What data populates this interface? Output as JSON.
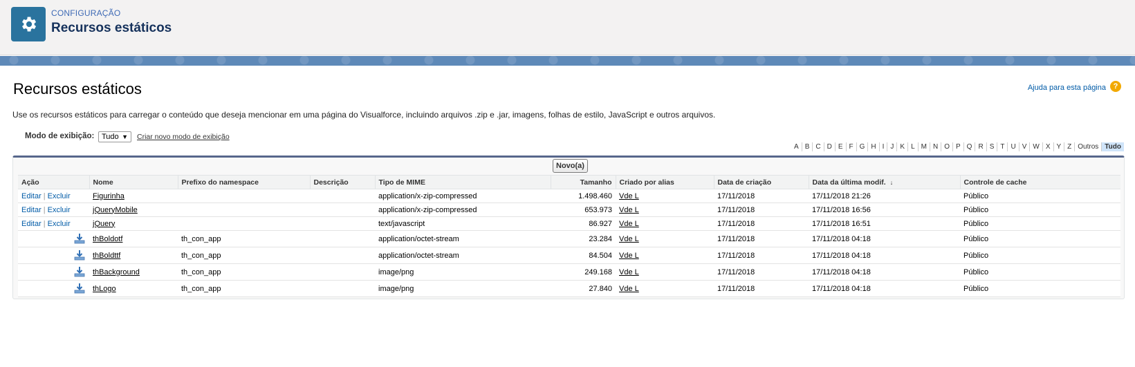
{
  "header": {
    "kicker": "CONFIGURAÇÃO",
    "title": "Recursos estáticos",
    "icon": "gear-icon"
  },
  "page": {
    "title": "Recursos estáticos",
    "help_link": "Ajuda para esta página",
    "help_icon": "?",
    "description": "Use os recursos estáticos para carregar o conteúdo que deseja mencionar em uma página do Visualforce, incluindo arquivos .zip e .jar, imagens, folhas de estilo, JavaScript e outros arquivos."
  },
  "view": {
    "label": "Modo de exibição:",
    "selected": "Tudo",
    "arrow": "▼",
    "create_link": "Criar novo modo de exibição"
  },
  "alphabet": [
    "A",
    "B",
    "C",
    "D",
    "E",
    "F",
    "G",
    "H",
    "I",
    "J",
    "K",
    "L",
    "M",
    "N",
    "O",
    "P",
    "Q",
    "R",
    "S",
    "T",
    "U",
    "V",
    "W",
    "X",
    "Y",
    "Z",
    "Outros",
    "Tudo"
  ],
  "alphabet_active": "Tudo",
  "list": {
    "new_button": "Novo(a)",
    "columns": {
      "action": "Ação",
      "name": "Nome",
      "namespace": "Prefixo do namespace",
      "description": "Descrição",
      "mime": "Tipo de MIME",
      "size": "Tamanho",
      "created_by": "Criado por alias",
      "created_date": "Data de criação",
      "modified_date": "Data da última modif.",
      "cache": "Controle de cache"
    },
    "sort_indicator": "↓",
    "edit_label": "Editar",
    "delete_label": "Excluir",
    "action_separator": "|",
    "rows": [
      {
        "name": "Figurinha",
        "namespace": "",
        "description": "",
        "mime": "application/x-zip-compressed",
        "size": "1.498.460",
        "created_by": "Vde L",
        "created_date": "17/11/2018",
        "modified_date": "17/11/2018 21:26",
        "cache": "Público",
        "editable": true
      },
      {
        "name": "jQueryMobile",
        "namespace": "",
        "description": "",
        "mime": "application/x-zip-compressed",
        "size": "653.973",
        "created_by": "Vde L",
        "created_date": "17/11/2018",
        "modified_date": "17/11/2018 16:56",
        "cache": "Público",
        "editable": true
      },
      {
        "name": "jQuery",
        "namespace": "",
        "description": "",
        "mime": "text/javascript",
        "size": "86.927",
        "created_by": "Vde L",
        "created_date": "17/11/2018",
        "modified_date": "17/11/2018 16:51",
        "cache": "Público",
        "editable": true
      },
      {
        "name": "thBoldotf",
        "namespace": "th_con_app",
        "description": "",
        "mime": "application/octet-stream",
        "size": "23.284",
        "created_by": "Vde L",
        "created_date": "17/11/2018",
        "modified_date": "17/11/2018 04:18",
        "cache": "Público",
        "editable": false
      },
      {
        "name": "thBoldttf",
        "namespace": "th_con_app",
        "description": "",
        "mime": "application/octet-stream",
        "size": "84.504",
        "created_by": "Vde L",
        "created_date": "17/11/2018",
        "modified_date": "17/11/2018 04:18",
        "cache": "Público",
        "editable": false
      },
      {
        "name": "thBackground",
        "namespace": "th_con_app",
        "description": "",
        "mime": "image/png",
        "size": "249.168",
        "created_by": "Vde L",
        "created_date": "17/11/2018",
        "modified_date": "17/11/2018 04:18",
        "cache": "Público",
        "editable": false
      },
      {
        "name": "thLogo",
        "namespace": "th_con_app",
        "description": "",
        "mime": "image/png",
        "size": "27.840",
        "created_by": "Vde L",
        "created_date": "17/11/2018",
        "modified_date": "17/11/2018 04:18",
        "cache": "Público",
        "editable": false
      }
    ]
  },
  "colors": {
    "header_bg": "#f3f2f2",
    "gear_tile": "#2a739e",
    "kicker": "#3e6ab5",
    "band": "#5e89b8",
    "link": "#015ba7",
    "list_border": "#56668b",
    "help_icon": "#f2a900"
  }
}
